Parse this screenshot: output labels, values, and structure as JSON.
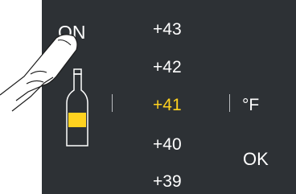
{
  "power": {
    "label": "ON"
  },
  "temperature": {
    "values": [
      "+43",
      "+42",
      "+41",
      "+40",
      "+39"
    ],
    "selected_index": 2,
    "selected_color": "#ffd21f"
  },
  "unit": {
    "label": "°F"
  },
  "confirm": {
    "label": "OK"
  },
  "bottle_fill_fraction": 0.4,
  "colors": {
    "panel": "#2d3135",
    "text": "#ffffff",
    "accent": "#ffd21f"
  },
  "icons": [
    "wine-bottle-icon",
    "pointing-hand-icon"
  ]
}
